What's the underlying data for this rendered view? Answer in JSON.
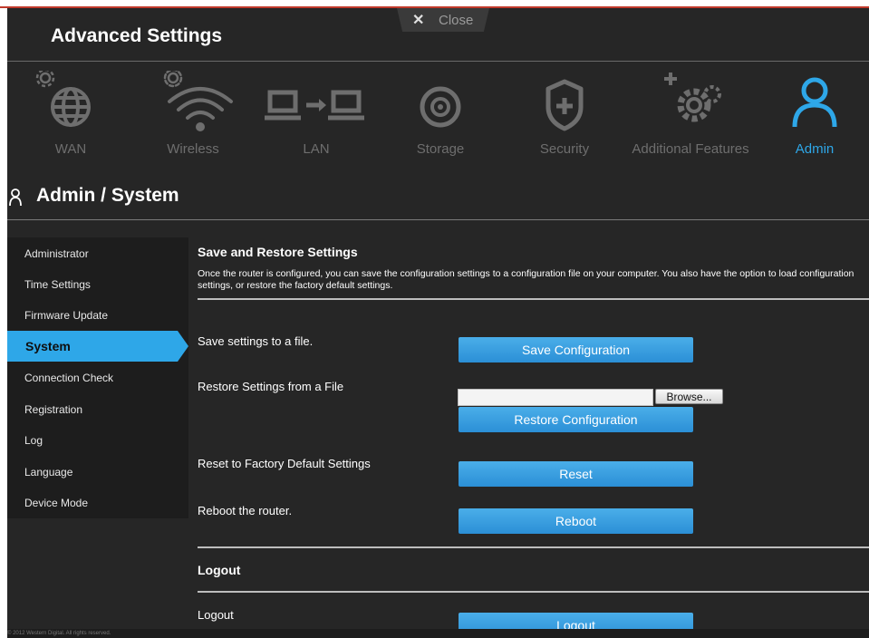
{
  "window": {
    "close_label": "Close"
  },
  "header": {
    "title": "Advanced Settings"
  },
  "nav": {
    "items": [
      {
        "label": "WAN",
        "icon": "globe-gear-icon"
      },
      {
        "label": "Wireless",
        "icon": "wifi-gear-icon"
      },
      {
        "label": "LAN",
        "icon": "lan-computers-icon"
      },
      {
        "label": "Storage",
        "icon": "storage-disc-icon"
      },
      {
        "label": "Security",
        "icon": "shield-plus-icon"
      },
      {
        "label": "Additional Features",
        "icon": "gears-plus-icon"
      },
      {
        "label": "Admin",
        "icon": "person-icon"
      }
    ],
    "active": "Admin",
    "active_color": "#2ea7e8",
    "inactive_color": "#6e6e6e"
  },
  "page": {
    "title": "Admin / System"
  },
  "sidebar": {
    "items": [
      {
        "label": "Administrator"
      },
      {
        "label": "Time Settings"
      },
      {
        "label": "Firmware Update"
      },
      {
        "label": "System"
      },
      {
        "label": "Connection Check"
      },
      {
        "label": "Registration"
      },
      {
        "label": "Log"
      },
      {
        "label": "Language"
      },
      {
        "label": "Device Mode"
      }
    ],
    "active": "System"
  },
  "main": {
    "save_restore": {
      "title": "Save and Restore Settings",
      "description": "Once the router is configured, you can save the configuration settings to a configuration file on your computer. You also have the option to load configuration settings, or restore the factory default settings."
    },
    "rows": {
      "save_label": "Save settings to a file.",
      "save_button": "Save Configuration",
      "restore_label": "Restore Settings from a File",
      "file_value": "",
      "browse_button": "Browse...",
      "restore_button": "Restore Configuration",
      "reset_label": "Reset to Factory Default Settings",
      "reset_button": "Reset",
      "reboot_label": "Reboot the router.",
      "reboot_button": "Reboot"
    },
    "logout": {
      "title": "Logout",
      "label": "Logout",
      "button": "Logout"
    }
  },
  "footer": {
    "text": "© 2012 Western Digital. All rights reserved."
  },
  "colors": {
    "accent": "#2ea7e8",
    "background": "#262626",
    "sidebar": "#1d1d1d"
  }
}
